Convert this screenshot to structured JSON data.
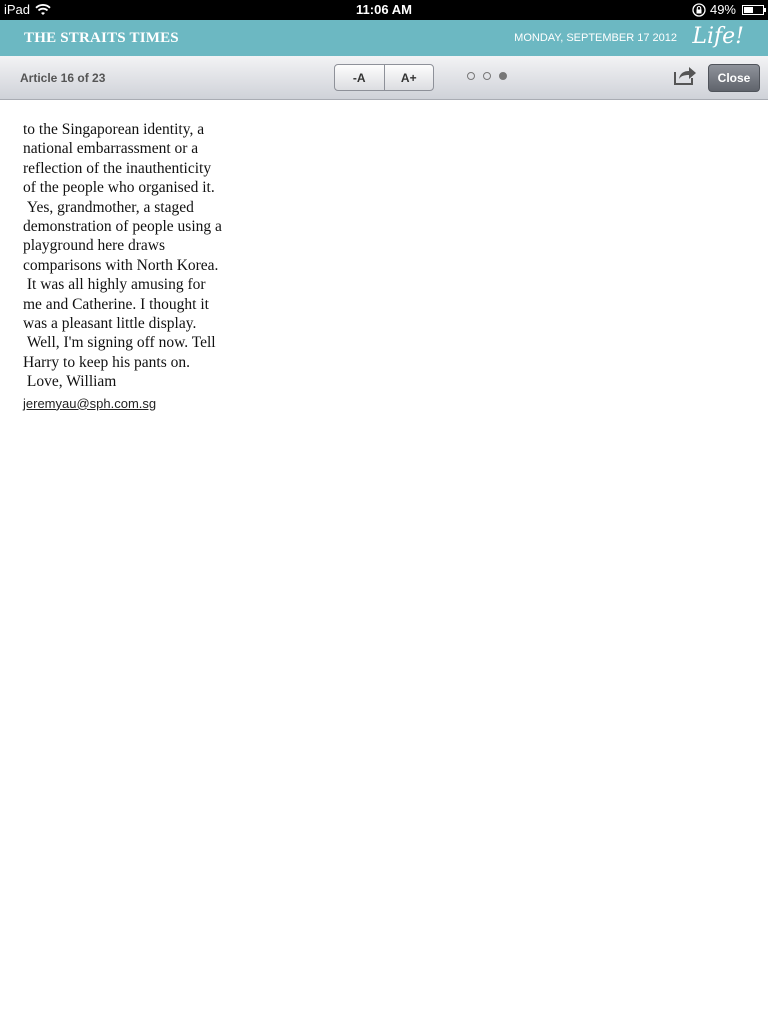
{
  "status_bar": {
    "device": "iPad",
    "time": "11:06 AM",
    "battery": "49%",
    "battery_level": 0.49
  },
  "masthead": {
    "title": "THE STRAITS TIMES",
    "date": "MONDAY, SEPTEMBER 17 2012",
    "brand": "Life!"
  },
  "toolbar": {
    "article_count": "Article 16 of 23",
    "font_decrease_label": "-A",
    "font_increase_label": "A+",
    "page_dots": 3,
    "active_page": 3,
    "close_label": "Close"
  },
  "article": {
    "lines": [
      "to the Singaporean identity, a",
      "national embarrassment or a",
      "reflection of the inauthenticity",
      "of the people who organised it.",
      " Yes, grandmother, a staged",
      "demonstration of people using a",
      "playground here draws",
      "comparisons with North Korea.",
      " It was all highly amusing for",
      "me and Catherine. I thought it",
      "was a pleasant little display.",
      " Well, I'm signing off now. Tell",
      "Harry to keep his pants on.",
      " Love, William"
    ],
    "email": "jeremyau@sph.com.sg"
  },
  "icons": {
    "wifi": "wifi-icon",
    "rotation_lock": "rotation-lock-icon",
    "battery": "battery-icon",
    "share": "share-icon"
  }
}
